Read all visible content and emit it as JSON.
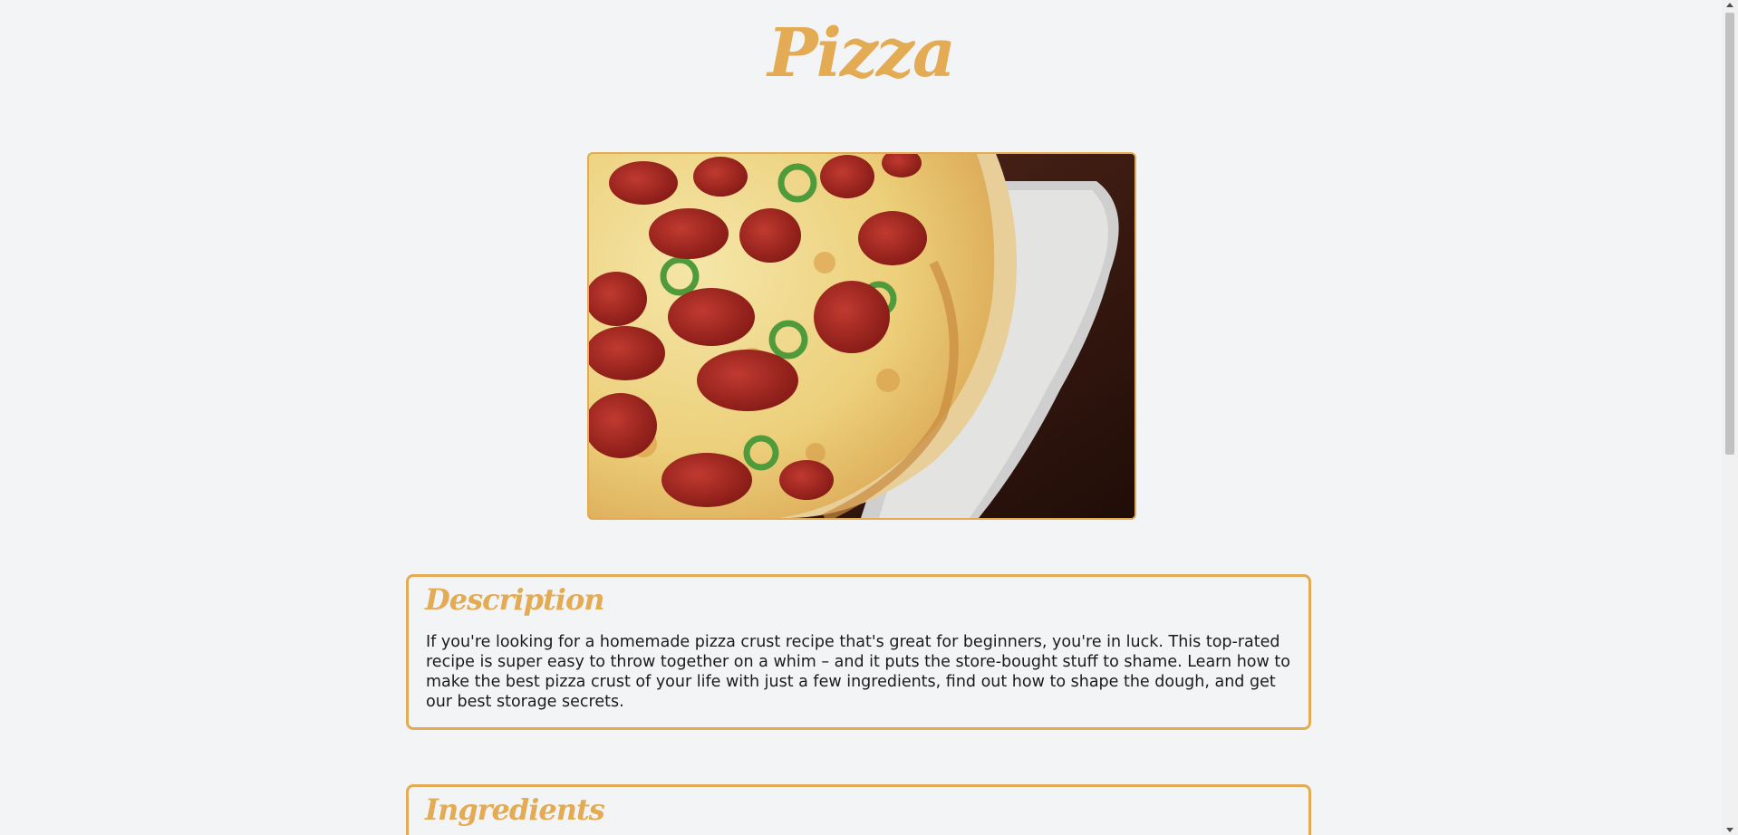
{
  "page": {
    "title": "Pizza"
  },
  "hero": {
    "alt": "Pepperoni pizza with jalapeños on a pizza peel"
  },
  "description": {
    "heading": "Description",
    "text": "If you're looking for a homemade pizza crust recipe that's great for beginners, you're in luck. This top-rated recipe is super easy to throw together on a whim – and it puts the store-bought stuff to shame. Learn how to make the best pizza crust of your life with just a few ingredients, find out how to shape the dough, and get our best storage secrets."
  },
  "ingredients": {
    "heading": "Ingredients"
  },
  "colors": {
    "accent": "#e2ab54",
    "background": "#f3f4f6",
    "text": "#1b1b1b"
  }
}
